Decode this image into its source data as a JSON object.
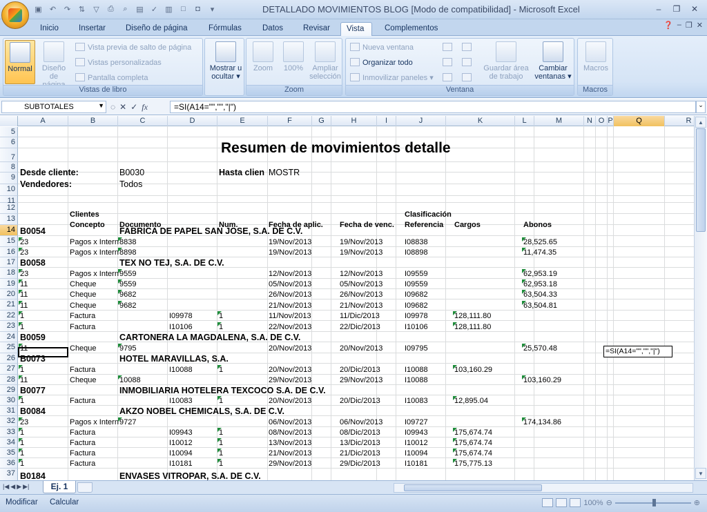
{
  "window": {
    "title": "DETALLADO MOVIMIENTOS BLOG  [Modo de compatibilidad] - Microsoft Excel"
  },
  "tabs": [
    "Inicio",
    "Insertar",
    "Diseño de página",
    "Fórmulas",
    "Datos",
    "Revisar",
    "Vista",
    "Complementos"
  ],
  "active_tab": "Vista",
  "ribbon": {
    "libro": {
      "label": "Vistas de libro",
      "normal": "Normal",
      "diseno": "Diseño de página",
      "previa": "Vista previa de salto de página",
      "personalizadas": "Vistas personalizadas",
      "completa": "Pantalla completa"
    },
    "mostrar": {
      "label": "Mostrar u ocultar"
    },
    "zoom": {
      "label": "Zoom",
      "zoom": "Zoom",
      "cien": "100%",
      "ampliar": "Ampliar selección"
    },
    "ventana": {
      "label": "Ventana",
      "nueva": "Nueva ventana",
      "organizar": "Organizar todo",
      "inmovilizar": "Inmovilizar paneles",
      "guardar": "Guardar área de trabajo",
      "cambiar": "Cambiar ventanas"
    },
    "macros": {
      "label": "Macros",
      "macros": "Macros"
    }
  },
  "formula_bar": {
    "name_box": "SUBTOTALES",
    "formula": "=SI(A14=\"\",\"\",\"|\")"
  },
  "columns": [
    "A",
    "B",
    "C",
    "D",
    "E",
    "F",
    "G",
    "H",
    "I",
    "J",
    "K",
    "L",
    "M",
    "N",
    "O",
    "P",
    "Q",
    "R"
  ],
  "rows": [
    "5",
    "6",
    "7",
    "8",
    "9",
    "10",
    "11",
    "12",
    "13",
    "14",
    "15",
    "16",
    "17",
    "18",
    "19",
    "20",
    "21",
    "22",
    "23",
    "24",
    "25",
    "26",
    "27",
    "28",
    "29",
    "30",
    "31",
    "32",
    "33",
    "34",
    "35",
    "36",
    "37"
  ],
  "sheet": {
    "title": "Resumen de movimientos detalle",
    "desde_label": "Desde cliente:",
    "desde_val": "B0030",
    "hasta_label": "Hasta clien",
    "hasta_val": "MOSTR",
    "vend_label": "Vendedores:",
    "vend_val": "Todos",
    "h12": {
      "clientes": "Clientes",
      "clasif": "Clasificación"
    },
    "h13": {
      "concepto": "Concepto",
      "documento": "Documento",
      "num": "Num.",
      "aplic": "Fecha de aplic.",
      "venc": "Fecha de venc.",
      "ref": "Referencia",
      "cargos": "Cargos",
      "abonos": "Abonos"
    },
    "edit_formula": "=SI(A14=\"\",\"\",\"|\")",
    "lines": [
      {
        "r": "14",
        "type": "client",
        "code": "B0054",
        "name": "FABRICA DE PAPEL SAN JOSE, S.A. DE C.V."
      },
      {
        "r": "15",
        "type": "mov",
        "a": "23",
        "b": "Pagos x Intern",
        "c": "8838",
        "d": "",
        "e": "",
        "f": "19/Nov/2013",
        "h": "19/Nov/2013",
        "j": "I08838",
        "k": "",
        "m": "28,525.65"
      },
      {
        "r": "16",
        "type": "mov",
        "a": "23",
        "b": "Pagos x Intern",
        "c": "8898",
        "d": "",
        "e": "",
        "f": "19/Nov/2013",
        "h": "19/Nov/2013",
        "j": "I08898",
        "k": "",
        "m": "11,474.35"
      },
      {
        "r": "17",
        "type": "client",
        "code": "B0058",
        "name": "TEX NO TEJ, S.A. DE C.V."
      },
      {
        "r": "18",
        "type": "mov",
        "a": "23",
        "b": "Pagos x Intern",
        "c": "9559",
        "d": "",
        "e": "",
        "f": "12/Nov/2013",
        "h": "12/Nov/2013",
        "j": "I09559",
        "k": "",
        "m": "62,953.19"
      },
      {
        "r": "19",
        "type": "mov",
        "a": "11",
        "b": "Cheque",
        "c": "9559",
        "d": "",
        "e": "",
        "f": "05/Nov/2013",
        "h": "05/Nov/2013",
        "j": "I09559",
        "k": "",
        "m": "62,953.18"
      },
      {
        "r": "20",
        "type": "mov",
        "a": "11",
        "b": "Cheque",
        "c": "9682",
        "d": "",
        "e": "",
        "f": "26/Nov/2013",
        "h": "26/Nov/2013",
        "j": "I09682",
        "k": "",
        "m": "63,504.33"
      },
      {
        "r": "21",
        "type": "mov",
        "a": "11",
        "b": "Cheque",
        "c": "9682",
        "d": "",
        "e": "",
        "f": "21/Nov/2013",
        "h": "21/Nov/2013",
        "j": "I09682",
        "k": "",
        "m": "63,504.81"
      },
      {
        "r": "22",
        "type": "mov",
        "a": "1",
        "b": "Factura",
        "c": "",
        "d": "I09978",
        "e": "1",
        "f": "11/Nov/2013",
        "h": "11/Dic/2013",
        "j": "I09978",
        "k": "128,111.80",
        "m": ""
      },
      {
        "r": "23",
        "type": "mov",
        "a": "1",
        "b": "Factura",
        "c": "",
        "d": "I10106",
        "e": "1",
        "f": "22/Nov/2013",
        "h": "22/Dic/2013",
        "j": "I10106",
        "k": "128,111.80",
        "m": ""
      },
      {
        "r": "24",
        "type": "client",
        "code": "B0059",
        "name": "CARTONERA LA MAGDALENA, S.A.  DE C.V."
      },
      {
        "r": "25",
        "type": "mov",
        "a": "11",
        "b": "Cheque",
        "c": "9795",
        "d": "",
        "e": "",
        "f": "20/Nov/2013",
        "h": "20/Nov/2013",
        "j": "I09795",
        "k": "",
        "m": "25,570.48"
      },
      {
        "r": "26",
        "type": "client",
        "code": "B0073",
        "name": "HOTEL MARAVILLAS, S.A."
      },
      {
        "r": "27",
        "type": "mov",
        "a": "1",
        "b": "Factura",
        "c": "",
        "d": "I10088",
        "e": "1",
        "f": "20/Nov/2013",
        "h": "20/Dic/2013",
        "j": "I10088",
        "k": "103,160.29",
        "m": ""
      },
      {
        "r": "28",
        "type": "mov",
        "a": "11",
        "b": "Cheque",
        "c": "10088",
        "d": "",
        "e": "",
        "f": "29/Nov/2013",
        "h": "29/Nov/2013",
        "j": "I10088",
        "k": "",
        "m": "103,160.29"
      },
      {
        "r": "29",
        "type": "client",
        "code": "B0077",
        "name": "INMOBILIARIA HOTELERA TEXCOCO S.A. DE C.V."
      },
      {
        "r": "30",
        "type": "mov",
        "a": "1",
        "b": "Factura",
        "c": "",
        "d": "I10083",
        "e": "1",
        "f": "20/Nov/2013",
        "h": "20/Dic/2013",
        "j": "I10083",
        "k": "12,895.04",
        "m": ""
      },
      {
        "r": "31",
        "type": "client",
        "code": "B0084",
        "name": "AKZO NOBEL CHEMICALS, S.A. DE C.V."
      },
      {
        "r": "32",
        "type": "mov",
        "a": "23",
        "b": "Pagos x Intern",
        "c": "9727",
        "d": "",
        "e": "",
        "f": "06/Nov/2013",
        "h": "06/Nov/2013",
        "j": "I09727",
        "k": "",
        "m": "174,134.86"
      },
      {
        "r": "33",
        "type": "mov",
        "a": "1",
        "b": "Factura",
        "c": "",
        "d": "I09943",
        "e": "1",
        "f": "08/Nov/2013",
        "h": "08/Dic/2013",
        "j": "I09943",
        "k": "175,674.74",
        "m": ""
      },
      {
        "r": "34",
        "type": "mov",
        "a": "1",
        "b": "Factura",
        "c": "",
        "d": "I10012",
        "e": "1",
        "f": "13/Nov/2013",
        "h": "13/Dic/2013",
        "j": "I10012",
        "k": "175,674.74",
        "m": ""
      },
      {
        "r": "35",
        "type": "mov",
        "a": "1",
        "b": "Factura",
        "c": "",
        "d": "I10094",
        "e": "1",
        "f": "21/Nov/2013",
        "h": "21/Dic/2013",
        "j": "I10094",
        "k": "175,674.74",
        "m": ""
      },
      {
        "r": "36",
        "type": "mov",
        "a": "1",
        "b": "Factura",
        "c": "",
        "d": "I10181",
        "e": "1",
        "f": "29/Nov/2013",
        "h": "29/Dic/2013",
        "j": "I10181",
        "k": "175,775.13",
        "m": ""
      },
      {
        "r": "37",
        "type": "client",
        "code": "B0184",
        "name": "ENVASES VITROPAR, S.A. DE C.V."
      }
    ]
  },
  "sheet_tab": "Ej. 1",
  "status": {
    "mode": "Modificar",
    "calc": "Calcular",
    "zoom": "100%"
  }
}
